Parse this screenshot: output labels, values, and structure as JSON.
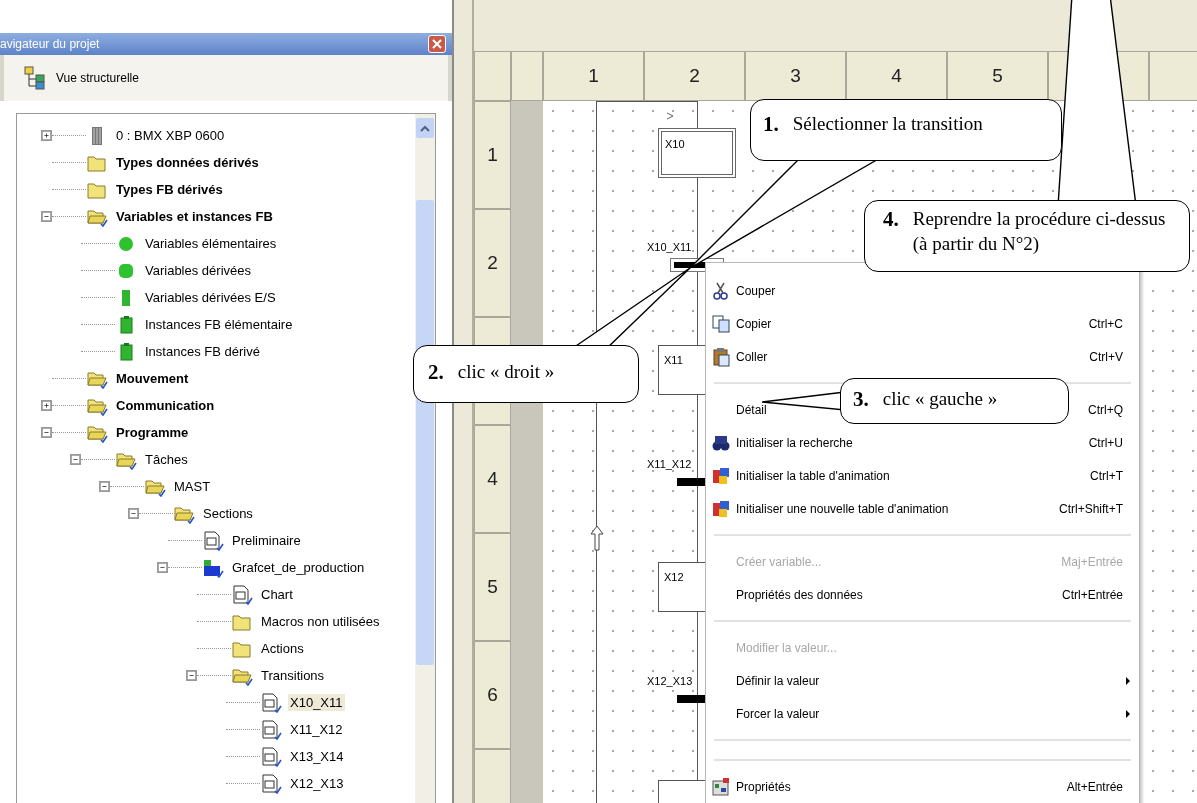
{
  "navigator": {
    "title": "avigateur du projet",
    "view_label": "Vue structurelle",
    "tree": [
      {
        "label": "0 : BMX XBP 0600",
        "kind": "rack",
        "bold": false,
        "expanded": false,
        "selected": false
      },
      {
        "label": "Types données dérivés",
        "kind": "folder",
        "bold": true,
        "selected": false
      },
      {
        "label": "Types FB dérivés",
        "kind": "folder",
        "bold": true,
        "selected": false
      },
      {
        "label": "Variables et instances FB",
        "kind": "folder_open",
        "bold": true,
        "expanded": true,
        "selected": false,
        "children": [
          {
            "label": "Variables élémentaires",
            "kind": "var_elem",
            "bold": false,
            "selected": false
          },
          {
            "label": "Variables dérivées",
            "kind": "var_derived",
            "bold": false,
            "selected": false
          },
          {
            "label": "Variables dérivées E/S",
            "kind": "var_io",
            "bold": false,
            "selected": false
          },
          {
            "label": "Instances FB élémentaire",
            "kind": "fb_elem",
            "bold": false,
            "selected": false
          },
          {
            "label": "Instances FB dérivé",
            "kind": "fb_derived",
            "bold": false,
            "selected": false
          }
        ]
      },
      {
        "label": "Mouvement",
        "kind": "folder_open",
        "bold": true,
        "selected": false
      },
      {
        "label": "Communication",
        "kind": "folder_open",
        "bold": true,
        "expanded": false,
        "selected": false
      },
      {
        "label": "Programme",
        "kind": "folder_open",
        "bold": true,
        "expanded": true,
        "selected": false,
        "children": [
          {
            "label": "Tâches",
            "kind": "folder_open",
            "bold": false,
            "expanded": true,
            "selected": false,
            "children": [
              {
                "label": "MAST",
                "kind": "folder_open",
                "bold": false,
                "expanded": true,
                "selected": false,
                "children": [
                  {
                    "label": "Sections",
                    "kind": "folder_open",
                    "bold": false,
                    "expanded": true,
                    "selected": false,
                    "children": [
                      {
                        "label": "Preliminaire",
                        "kind": "ld",
                        "bold": false,
                        "selected": false
                      },
                      {
                        "label": "Grafcet_de_production",
                        "kind": "sfc",
                        "bold": false,
                        "expanded": true,
                        "selected": false,
                        "children": [
                          {
                            "label": "Chart",
                            "kind": "fc",
                            "bold": false,
                            "selected": false
                          },
                          {
                            "label": "Macros non utilisées",
                            "kind": "folder",
                            "bold": false,
                            "selected": false
                          },
                          {
                            "label": "Actions",
                            "kind": "folder",
                            "bold": false,
                            "selected": false
                          },
                          {
                            "label": "Transitions",
                            "kind": "folder_open",
                            "bold": false,
                            "expanded": true,
                            "selected": false,
                            "children": [
                              {
                                "label": "X10_X11",
                                "kind": "ld",
                                "bold": false,
                                "selected": true
                              },
                              {
                                "label": "X11_X12",
                                "kind": "ld",
                                "bold": false,
                                "selected": false
                              },
                              {
                                "label": "X13_X14",
                                "kind": "ld",
                                "bold": false,
                                "selected": false
                              },
                              {
                                "label": "X12_X13",
                                "kind": "ld",
                                "bold": false,
                                "selected": false
                              }
                            ]
                          }
                        ]
                      }
                    ]
                  }
                ]
              }
            ]
          }
        ]
      }
    ]
  },
  "editor": {
    "columns": [
      "1",
      "2",
      "3",
      "4",
      "5"
    ],
    "rows": [
      {
        "label": "1"
      },
      {
        "label": "2"
      },
      {},
      {
        "label": "4"
      },
      {
        "label": "5"
      },
      {
        "label": "6"
      }
    ],
    "steps": [
      {
        "name": "X10",
        "initial": true
      },
      {
        "name": "X11",
        "initial": false
      },
      {
        "name": "X12",
        "initial": false
      }
    ],
    "transitions": [
      {
        "name": "X10_X11",
        "selected": true
      },
      {
        "name": "X11_X12",
        "selected": false
      },
      {
        "name": "X12_X13",
        "selected": false
      }
    ]
  },
  "context_menu": [
    {
      "kind": "cut",
      "label": "Couper",
      "disabled": false
    },
    {
      "kind": "copy",
      "label": "Copier",
      "shortcut": "Ctrl+C",
      "disabled": false
    },
    {
      "kind": "paste",
      "label": "Coller",
      "shortcut": "Ctrl+V",
      "disabled": false
    },
    {
      "kind": "separator"
    },
    {
      "kind": "plain",
      "label": "Détail",
      "shortcut": "Ctrl+Q",
      "disabled": false
    },
    {
      "kind": "search",
      "label": "Initialiser la recherche",
      "shortcut": "Ctrl+U",
      "disabled": false
    },
    {
      "kind": "animation",
      "label": "Initialiser la table d'animation",
      "shortcut": "Ctrl+T",
      "disabled": false
    },
    {
      "kind": "animation",
      "label": "Initialiser une nouvelle table d'animation",
      "shortcut": "Ctrl+Shift+T",
      "disabled": false
    },
    {
      "kind": "separator"
    },
    {
      "kind": "plain",
      "label": "Créer variable...",
      "shortcut": "Maj+Entrée",
      "disabled": true
    },
    {
      "kind": "plain",
      "label": "Propriétés des données",
      "shortcut": "Ctrl+Entrée",
      "disabled": false
    },
    {
      "kind": "separator"
    },
    {
      "kind": "plain",
      "label": "Modifier la valeur...",
      "disabled": true
    },
    {
      "kind": "plain",
      "label": "Définir la valeur",
      "disabled": false,
      "submenu": true
    },
    {
      "kind": "plain",
      "label": "Forcer la valeur",
      "disabled": false,
      "submenu": true
    },
    {
      "kind": "separator"
    },
    {
      "kind": "separator"
    },
    {
      "kind": "properties",
      "label": "Propriétés",
      "shortcut": "Alt+Entrée",
      "disabled": false
    }
  ],
  "callouts": [
    {
      "number": "1.",
      "text": "Sélectionner la transition"
    },
    {
      "number": "4.",
      "text": "Reprendre la procédure ci-dessus (à partir du N°2)"
    },
    {
      "number": "2.",
      "text": "clic « droit »"
    },
    {
      "number": "3.",
      "text": "clic « gauche »"
    }
  ]
}
